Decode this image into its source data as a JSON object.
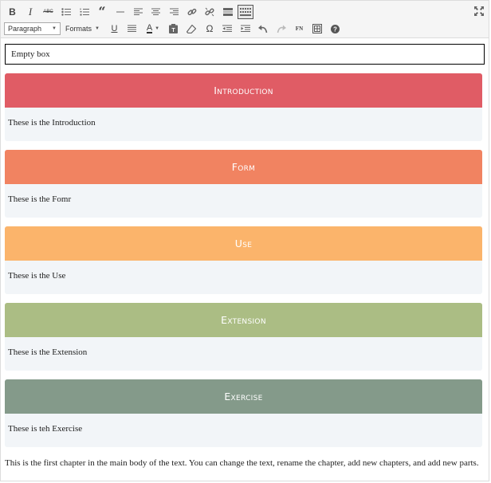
{
  "toolbar": {
    "row1": [
      {
        "name": "bold-button",
        "glyph": "B"
      },
      {
        "name": "italic-button",
        "glyph": "I"
      },
      {
        "name": "strikethrough-button",
        "glyph": "ABC"
      },
      {
        "name": "bullet-list-button",
        "glyph": "bullets"
      },
      {
        "name": "numbered-list-button",
        "glyph": "numbers"
      },
      {
        "name": "blockquote-button",
        "glyph": "quote"
      },
      {
        "name": "horizontal-line-button",
        "glyph": "hr"
      },
      {
        "name": "align-left-button",
        "glyph": "align-left"
      },
      {
        "name": "align-center-button",
        "glyph": "align-center"
      },
      {
        "name": "align-right-button",
        "glyph": "align-right"
      },
      {
        "name": "insert-link-button",
        "glyph": "link"
      },
      {
        "name": "remove-link-button",
        "glyph": "unlink"
      },
      {
        "name": "read-more-button",
        "glyph": "more"
      },
      {
        "name": "toolbar-toggle-button",
        "glyph": "kitchen-sink"
      }
    ],
    "paragraph_select": "Paragraph",
    "formats_label": "Formats",
    "row2": [
      {
        "name": "underline-button",
        "glyph": "U"
      },
      {
        "name": "justify-button",
        "glyph": "justify"
      },
      {
        "name": "text-color-button",
        "glyph": "A"
      },
      {
        "name": "paste-as-text-button",
        "glyph": "paste"
      },
      {
        "name": "clear-formatting-button",
        "glyph": "eraser"
      },
      {
        "name": "special-character-button",
        "glyph": "Ω"
      },
      {
        "name": "outdent-button",
        "glyph": "outdent"
      },
      {
        "name": "indent-button",
        "glyph": "indent"
      },
      {
        "name": "undo-button",
        "glyph": "undo"
      },
      {
        "name": "redo-button",
        "glyph": "redo"
      },
      {
        "name": "footnote-button",
        "glyph": "FN"
      },
      {
        "name": "table-button",
        "glyph": "table"
      },
      {
        "name": "help-button",
        "glyph": "?"
      }
    ]
  },
  "content": {
    "empty_box": "Empty box",
    "sections": [
      {
        "title": "Introduction",
        "body": "These is the Introduction",
        "color": "#e05c65"
      },
      {
        "title": "Form",
        "body": "These is the Fomr",
        "color": "#f18361"
      },
      {
        "title": "Use",
        "body": "These is the Use",
        "color": "#fbb46b"
      },
      {
        "title": "Extension",
        "body": "These is the Extension",
        "color": "#abbd84"
      },
      {
        "title": "Exercise",
        "body": "These is teh Exercise",
        "color": "#849a8a"
      }
    ],
    "paragraph": "This is the first chapter in the main body of the text. You can change the text, rename the chapter, add new chapters, and add new parts."
  }
}
